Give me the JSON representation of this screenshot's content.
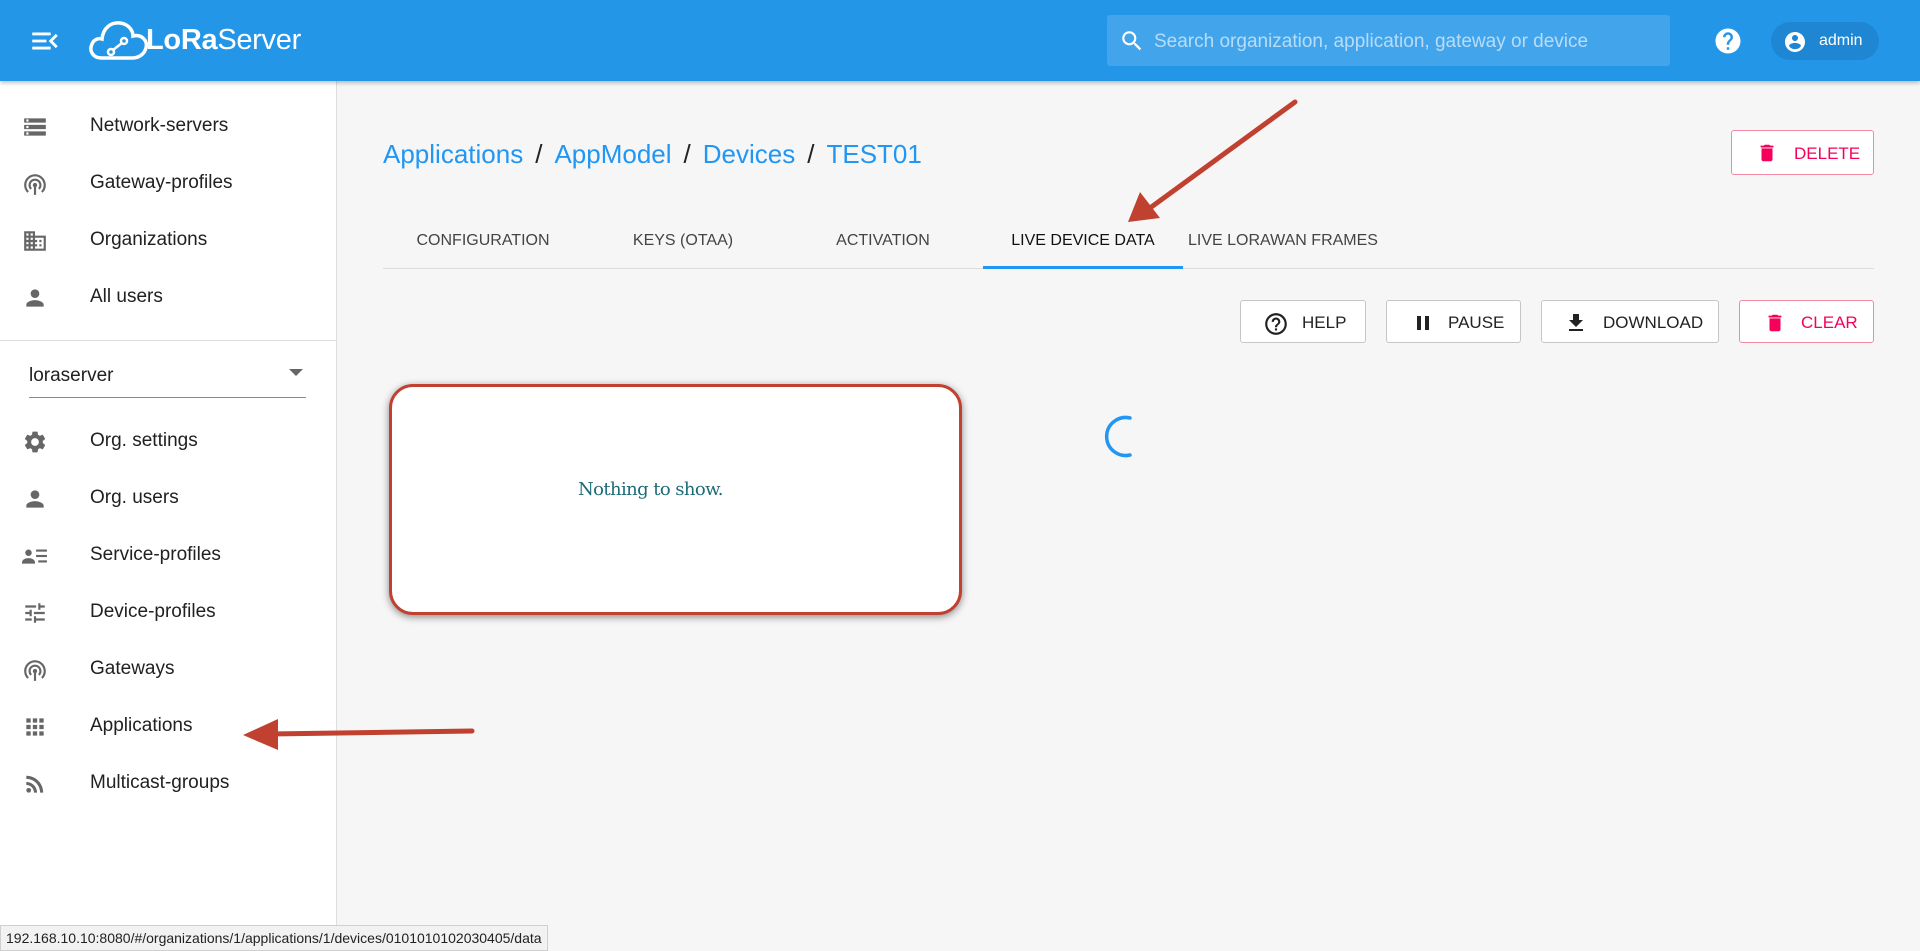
{
  "topbar": {
    "brand_prefix": "LoRa",
    "brand_suffix": "Server",
    "search_placeholder": "Search organization, application, gateway or device",
    "user_name": "admin",
    "bar_color": "#2496e8"
  },
  "sidebar": {
    "global_items": [
      {
        "label": "Network-servers",
        "icon": "server-icon"
      },
      {
        "label": "Gateway-profiles",
        "icon": "antenna-icon"
      },
      {
        "label": "Organizations",
        "icon": "building-icon"
      },
      {
        "label": "All users",
        "icon": "person-icon"
      }
    ],
    "org_selector_value": "loraserver",
    "org_items": [
      {
        "label": "Org. settings",
        "icon": "gear-icon"
      },
      {
        "label": "Org. users",
        "icon": "person-icon"
      },
      {
        "label": "Service-profiles",
        "icon": "profile-list-icon"
      },
      {
        "label": "Device-profiles",
        "icon": "sliders-icon"
      },
      {
        "label": "Gateways",
        "icon": "antenna-icon"
      },
      {
        "label": "Applications",
        "icon": "grid-icon"
      },
      {
        "label": "Multicast-groups",
        "icon": "rss-icon"
      }
    ]
  },
  "breadcrumb": {
    "items": [
      "Applications",
      "AppModel",
      "Devices",
      "TEST01"
    ],
    "separator": "/"
  },
  "actions": {
    "delete_label": "DELETE",
    "help_label": "HELP",
    "pause_label": "PAUSE",
    "download_label": "DOWNLOAD",
    "clear_label": "CLEAR"
  },
  "tabs": [
    {
      "label": "CONFIGURATION",
      "active": false
    },
    {
      "label": "KEYS (OTAA)",
      "active": false
    },
    {
      "label": "ACTIVATION",
      "active": false
    },
    {
      "label": "LIVE DEVICE DATA",
      "active": true
    },
    {
      "label": "LIVE LORAWAN FRAMES",
      "active": false
    }
  ],
  "content": {
    "empty_message": "Nothing to show."
  },
  "status_bar": {
    "url": "192.168.10.10:8080/#/organizations/1/applications/1/devices/0101010102030405/data"
  },
  "colors": {
    "accent": "#2196f3",
    "danger": "#f5005a",
    "annotation": "#c0412f"
  }
}
